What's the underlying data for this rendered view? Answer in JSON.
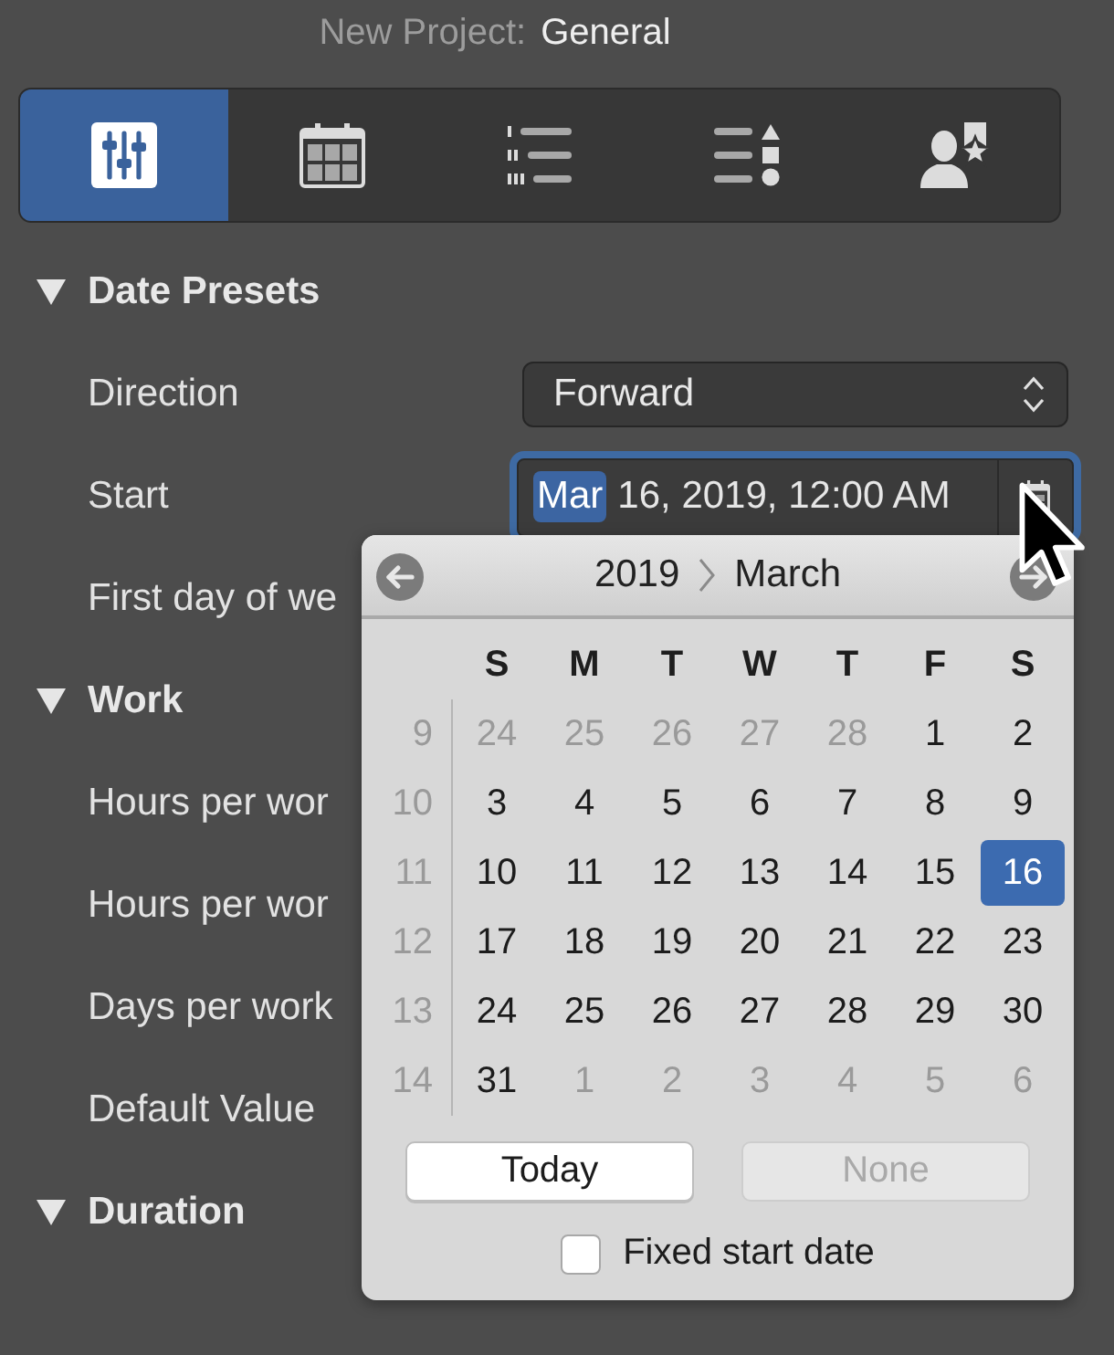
{
  "window": {
    "title_prefix": "New Project:",
    "title": "General"
  },
  "toolbar": {
    "tabs": [
      {
        "selected": true
      },
      {
        "selected": false
      },
      {
        "selected": false
      },
      {
        "selected": false
      },
      {
        "selected": false
      }
    ]
  },
  "sections": [
    {
      "title": "Date Presets",
      "expanded": true,
      "rows": [
        {
          "kind": "popup",
          "label": "Direction",
          "value": "Forward"
        },
        {
          "kind": "date",
          "label": "Start",
          "focused": true,
          "segments": [
            {
              "text": "Mar",
              "selected": true
            },
            {
              "text": "16, 2019, 12:00 AM",
              "selected": false
            }
          ]
        },
        {
          "kind": "label",
          "label": "First day of we"
        }
      ]
    },
    {
      "title": "Work",
      "expanded": true,
      "rows": [
        {
          "kind": "label",
          "label": "Hours per wor"
        },
        {
          "kind": "label",
          "label": "Hours per wor"
        },
        {
          "kind": "label",
          "label": "Days per work"
        },
        {
          "kind": "label",
          "label": "Default Value"
        }
      ]
    },
    {
      "title": "Duration",
      "expanded": true
    }
  ],
  "calendar_popover": {
    "year": "2019",
    "month": "March",
    "weekdays": [
      "S",
      "M",
      "T",
      "W",
      "T",
      "F",
      "S"
    ],
    "weeks": [
      {
        "number": "9",
        "days": [
          {
            "day": "24",
            "other_month": true,
            "selected": false
          },
          {
            "day": "25",
            "other_month": true,
            "selected": false
          },
          {
            "day": "26",
            "other_month": true,
            "selected": false
          },
          {
            "day": "27",
            "other_month": true,
            "selected": false
          },
          {
            "day": "28",
            "other_month": true,
            "selected": false
          },
          {
            "day": "1",
            "other_month": false,
            "selected": false
          },
          {
            "day": "2",
            "other_month": false,
            "selected": false
          }
        ]
      },
      {
        "number": "10",
        "days": [
          {
            "day": "3",
            "other_month": false,
            "selected": false
          },
          {
            "day": "4",
            "other_month": false,
            "selected": false
          },
          {
            "day": "5",
            "other_month": false,
            "selected": false
          },
          {
            "day": "6",
            "other_month": false,
            "selected": false
          },
          {
            "day": "7",
            "other_month": false,
            "selected": false
          },
          {
            "day": "8",
            "other_month": false,
            "selected": false
          },
          {
            "day": "9",
            "other_month": false,
            "selected": false
          }
        ]
      },
      {
        "number": "11",
        "days": [
          {
            "day": "10",
            "other_month": false,
            "selected": false
          },
          {
            "day": "11",
            "other_month": false,
            "selected": false
          },
          {
            "day": "12",
            "other_month": false,
            "selected": false
          },
          {
            "day": "13",
            "other_month": false,
            "selected": false
          },
          {
            "day": "14",
            "other_month": false,
            "selected": false
          },
          {
            "day": "15",
            "other_month": false,
            "selected": false
          },
          {
            "day": "16",
            "other_month": false,
            "selected": true
          }
        ]
      },
      {
        "number": "12",
        "days": [
          {
            "day": "17",
            "other_month": false,
            "selected": false
          },
          {
            "day": "18",
            "other_month": false,
            "selected": false
          },
          {
            "day": "19",
            "other_month": false,
            "selected": false
          },
          {
            "day": "20",
            "other_month": false,
            "selected": false
          },
          {
            "day": "21",
            "other_month": false,
            "selected": false
          },
          {
            "day": "22",
            "other_month": false,
            "selected": false
          },
          {
            "day": "23",
            "other_month": false,
            "selected": false
          }
        ]
      },
      {
        "number": "13",
        "days": [
          {
            "day": "24",
            "other_month": false,
            "selected": false
          },
          {
            "day": "25",
            "other_month": false,
            "selected": false
          },
          {
            "day": "26",
            "other_month": false,
            "selected": false
          },
          {
            "day": "27",
            "other_month": false,
            "selected": false
          },
          {
            "day": "28",
            "other_month": false,
            "selected": false
          },
          {
            "day": "29",
            "other_month": false,
            "selected": false
          },
          {
            "day": "30",
            "other_month": false,
            "selected": false
          }
        ]
      },
      {
        "number": "14",
        "days": [
          {
            "day": "31",
            "other_month": false,
            "selected": false
          },
          {
            "day": "1",
            "other_month": true,
            "selected": false
          },
          {
            "day": "2",
            "other_month": true,
            "selected": false
          },
          {
            "day": "3",
            "other_month": true,
            "selected": false
          },
          {
            "day": "4",
            "other_month": true,
            "selected": false
          },
          {
            "day": "5",
            "other_month": true,
            "selected": false
          },
          {
            "day": "6",
            "other_month": true,
            "selected": false
          }
        ]
      }
    ],
    "buttons": [
      {
        "label": "Today",
        "disabled": false
      },
      {
        "label": "None",
        "disabled": true
      }
    ],
    "checkbox": {
      "label": "Fixed start date",
      "checked": false
    }
  }
}
